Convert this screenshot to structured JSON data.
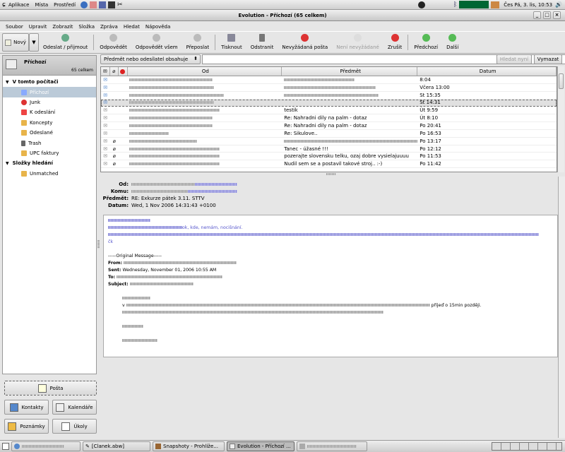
{
  "topbar": {
    "menus": [
      "Aplikace",
      "Místa",
      "Prostředí"
    ],
    "clock": "Čes Pá, 3. lis, 10:53"
  },
  "window": {
    "title": "Evolution - Příchozí (65 celkem)"
  },
  "menubar": [
    "Soubor",
    "Upravit",
    "Zobrazit",
    "Složka",
    "Zpráva",
    "Hledat",
    "Nápověda"
  ],
  "toolbar": {
    "new": "Nový",
    "send_receive": "Odeslat / přijmout",
    "reply": "Odpovědět",
    "reply_all": "Odpovědět všem",
    "forward": "Přeposlat",
    "print": "Tisknout",
    "delete": "Odstranit",
    "junk": "Nevyžádaná pošta",
    "not_junk": "Není nevyžádané",
    "cancel": "Zrušit",
    "prev": "Předchozí",
    "next": "Další"
  },
  "folder_header": {
    "name": "Příchozí",
    "count": "65 celkem"
  },
  "groups": {
    "local": "V tomto počítači",
    "search": "Složky hledání"
  },
  "folders": [
    "Příchozí",
    "Junk",
    "K odeslání",
    "Koncepty",
    "Odeslané",
    "Trash",
    "UPC faktury"
  ],
  "search_folders": [
    "Unmatched"
  ],
  "filter": {
    "select": "Předmět nebo odesílatel obsahuje",
    "find_now": "Hledat nyní",
    "clear": "Vymazat"
  },
  "columns": {
    "from": "Od",
    "subject": "Předmět",
    "date": "Datum"
  },
  "messages": [
    {
      "subject": "",
      "date": "8:04"
    },
    {
      "subject": "",
      "date": "Včera 13:00"
    },
    {
      "subject": "",
      "date": "St 15:35"
    },
    {
      "subject": "",
      "date": "St 14:31"
    },
    {
      "subject": "testik",
      "date": "Út 9:59"
    },
    {
      "subject": "Re: Nahradni dily na palm - dotaz",
      "date": "Út 8:10"
    },
    {
      "subject": "Re: Nahradni dily na palm - dotaz",
      "date": "Po 20:41"
    },
    {
      "subject": "Re: Sikulove..",
      "date": "Po 16:53"
    },
    {
      "subject": "",
      "date": "Po 13:17"
    },
    {
      "subject": "Tanec - úžasné !!!",
      "date": "Po 12:12"
    },
    {
      "subject": "pozerajte slovensku telku, ozaj dobre vysielajuuuu",
      "date": "Po 11:53"
    },
    {
      "subject": "Nudil sem se a postavil takové stroj.. :-)",
      "date": "Po 11:42"
    }
  ],
  "preview": {
    "labels": {
      "from": "Od:",
      "to": "Komu:",
      "subject": "Předmět:",
      "date": "Datum:"
    },
    "subject": "RE: Exkurze pátek 3.11. STTV",
    "date": "Wed, 1 Nov 2006 14:31:43 +0100",
    "body": {
      "link_tail": "ok, kde, nemám, nocišnání.",
      "link_short": "čk",
      "original": "-----Original Message-----",
      "from_label": "From:",
      "sent_label": "Sent:",
      "sent_value": "Wednesday, November 01, 2006 10:55 AM",
      "to_label": "To:",
      "subject_label": "Subject:",
      "v": "v",
      "tail": "příjeď o 15min později."
    }
  },
  "switcher": {
    "mail": "Pošta",
    "contacts": "Kontakty",
    "calendar": "Kalendáře",
    "memos": "Poznámky",
    "tasks": "Úkoly"
  },
  "taskbar": [
    "[Clanek.abw]",
    "Snapshoty - Prohlíže...",
    "Evolution - Příchozí ..."
  ]
}
